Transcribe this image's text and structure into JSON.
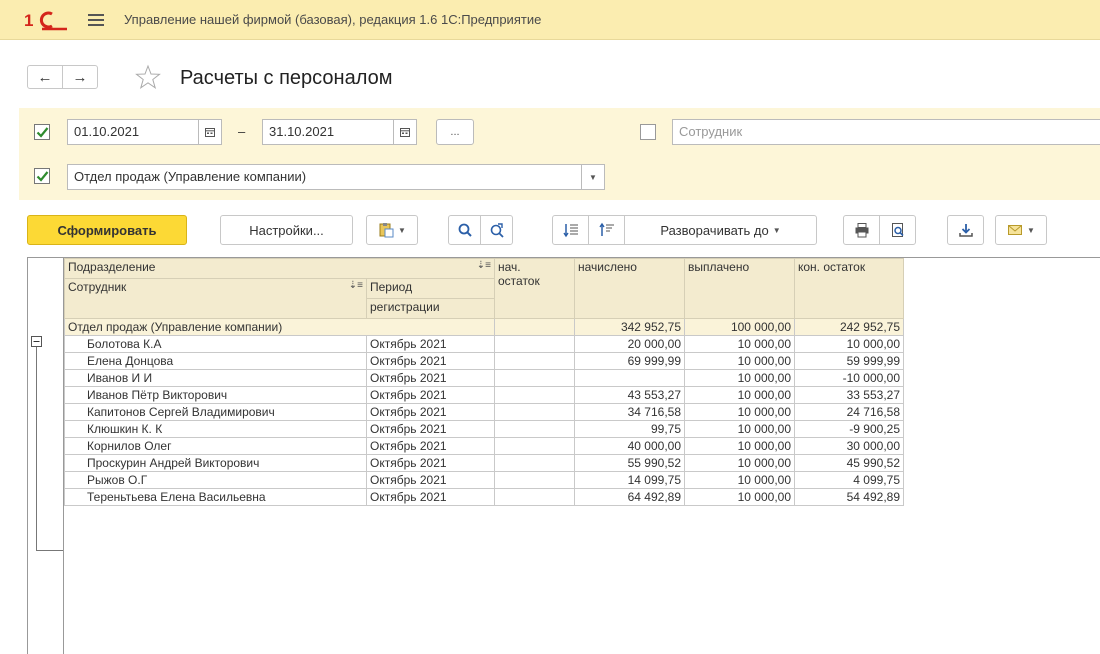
{
  "app": {
    "title": "Управление нашей фирмой (базовая), редакция 1.6 1С:Предприятие"
  },
  "form": {
    "title": "Расчеты с персоналом"
  },
  "filters": {
    "period_start": "01.10.2021",
    "period_end": "31.10.2021",
    "dash": "–",
    "choose_button": "...",
    "employee_placeholder": "Сотрудник",
    "department_value": "Отдел продаж (Управление компании)",
    "period_checked": true,
    "employee_checked": false,
    "department_checked": true
  },
  "toolbar": {
    "generate": "Сформировать",
    "settings": "Настройки...",
    "expand_to": "Разворачивать до"
  },
  "report": {
    "headers": {
      "department": "Подразделение",
      "employee": "Сотрудник",
      "period_line1": "Период",
      "period_line2": "регистрации",
      "start_balance_line1": "нач.",
      "start_balance_line2": "остаток",
      "accrued": "начислено",
      "paid": "выплачено",
      "end_balance": "кон. остаток"
    },
    "group": {
      "name": "Отдел продаж (Управление компании)",
      "start_balance": "",
      "accrued": "342 952,75",
      "paid": "100 000,00",
      "end_balance": "242 952,75"
    },
    "rows": [
      {
        "name": "Болотова  К.А",
        "period": "Октябрь 2021",
        "start": "",
        "accrued": "20 000,00",
        "paid": "10 000,00",
        "end": "10 000,00"
      },
      {
        "name": "Елена Донцова",
        "period": "Октябрь 2021",
        "start": "",
        "accrued": "69 999,99",
        "paid": "10 000,00",
        "end": "59 999,99"
      },
      {
        "name": "Иванов И И",
        "period": "Октябрь 2021",
        "start": "",
        "accrued": "",
        "paid": "10 000,00",
        "end": "-10 000,00"
      },
      {
        "name": "Иванов Пётр Викторович",
        "period": "Октябрь 2021",
        "start": "",
        "accrued": "43 553,27",
        "paid": "10 000,00",
        "end": "33 553,27"
      },
      {
        "name": "Капитонов Сергей Владимирович",
        "period": "Октябрь 2021",
        "start": "",
        "accrued": "34 716,58",
        "paid": "10 000,00",
        "end": "24 716,58"
      },
      {
        "name": "Клюшкин К. К",
        "period": "Октябрь 2021",
        "start": "",
        "accrued": "99,75",
        "paid": "10 000,00",
        "end": "-9 900,25"
      },
      {
        "name": "Корнилов Олег",
        "period": "Октябрь 2021",
        "start": "",
        "accrued": "40 000,00",
        "paid": "10 000,00",
        "end": "30 000,00"
      },
      {
        "name": "Проскурин Андрей Викторович",
        "period": "Октябрь 2021",
        "start": "",
        "accrued": "55 990,52",
        "paid": "10 000,00",
        "end": "45 990,52"
      },
      {
        "name": "Рыжов О.Г",
        "period": "Октябрь 2021",
        "start": "",
        "accrued": "14 099,75",
        "paid": "10 000,00",
        "end": "4 099,75"
      },
      {
        "name": "Тереньтьева Елена Васильевна",
        "period": "Октябрь 2021",
        "start": "",
        "accrued": "64 492,89",
        "paid": "10 000,00",
        "end": "54 492,89"
      }
    ]
  },
  "colors": {
    "titlebar_bg": "#fbedb0",
    "filter_bg": "#fdf6d8",
    "primary_button": "#fcd935",
    "logo_red": "#d4261b",
    "header_bg": "#f3ebcf",
    "check_green": "#2e8b2e"
  },
  "icons": [
    "1c-logo-icon",
    "menu-icon",
    "arrow-left-icon",
    "arrow-right-icon",
    "star-icon",
    "calendar-icon",
    "paste-icon",
    "search-icon",
    "refresh-icon",
    "sort-desc-icon",
    "sort-asc-icon",
    "print-icon",
    "preview-icon",
    "download-icon",
    "mail-icon",
    "collapse-icon"
  ]
}
